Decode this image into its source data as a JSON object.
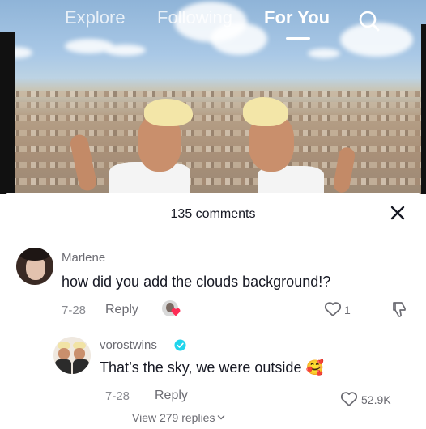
{
  "nav": {
    "explore": "Explore",
    "following": "Following",
    "for_you": "For You",
    "search_icon": "search-icon"
  },
  "comments_sheet": {
    "count_label": "135 comments",
    "close_icon": "close-icon"
  },
  "comments": [
    {
      "username": "Marlene",
      "text": "how did you add the clouds background!?",
      "date": "7-28",
      "reply_label": "Reply",
      "likes": "1"
    },
    {
      "username": "vorostwins",
      "verified": true,
      "text": "That’s the sky, we were outside 🥰",
      "date": "7-28",
      "reply_label": "Reply",
      "likes": "52.9K",
      "view_replies": "View 279 replies"
    }
  ],
  "colors": {
    "text_primary": "#161823",
    "text_secondary": "#6b6b72",
    "verified": "#20d5ec"
  }
}
